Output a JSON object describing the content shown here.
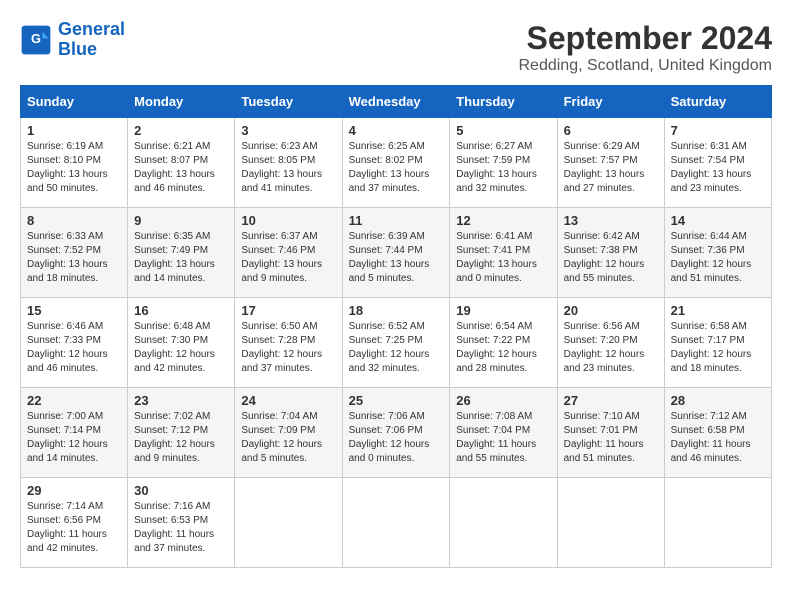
{
  "logo": {
    "line1": "General",
    "line2": "Blue"
  },
  "title": "September 2024",
  "location": "Redding, Scotland, United Kingdom",
  "days_header": [
    "Sunday",
    "Monday",
    "Tuesday",
    "Wednesday",
    "Thursday",
    "Friday",
    "Saturday"
  ],
  "weeks": [
    [
      {
        "day": "1",
        "sunrise": "6:19 AM",
        "sunset": "8:10 PM",
        "daylight": "13 hours and 50 minutes."
      },
      {
        "day": "2",
        "sunrise": "6:21 AM",
        "sunset": "8:07 PM",
        "daylight": "13 hours and 46 minutes."
      },
      {
        "day": "3",
        "sunrise": "6:23 AM",
        "sunset": "8:05 PM",
        "daylight": "13 hours and 41 minutes."
      },
      {
        "day": "4",
        "sunrise": "6:25 AM",
        "sunset": "8:02 PM",
        "daylight": "13 hours and 37 minutes."
      },
      {
        "day": "5",
        "sunrise": "6:27 AM",
        "sunset": "7:59 PM",
        "daylight": "13 hours and 32 minutes."
      },
      {
        "day": "6",
        "sunrise": "6:29 AM",
        "sunset": "7:57 PM",
        "daylight": "13 hours and 27 minutes."
      },
      {
        "day": "7",
        "sunrise": "6:31 AM",
        "sunset": "7:54 PM",
        "daylight": "13 hours and 23 minutes."
      }
    ],
    [
      {
        "day": "8",
        "sunrise": "6:33 AM",
        "sunset": "7:52 PM",
        "daylight": "13 hours and 18 minutes."
      },
      {
        "day": "9",
        "sunrise": "6:35 AM",
        "sunset": "7:49 PM",
        "daylight": "13 hours and 14 minutes."
      },
      {
        "day": "10",
        "sunrise": "6:37 AM",
        "sunset": "7:46 PM",
        "daylight": "13 hours and 9 minutes."
      },
      {
        "day": "11",
        "sunrise": "6:39 AM",
        "sunset": "7:44 PM",
        "daylight": "13 hours and 5 minutes."
      },
      {
        "day": "12",
        "sunrise": "6:41 AM",
        "sunset": "7:41 PM",
        "daylight": "13 hours and 0 minutes."
      },
      {
        "day": "13",
        "sunrise": "6:42 AM",
        "sunset": "7:38 PM",
        "daylight": "12 hours and 55 minutes."
      },
      {
        "day": "14",
        "sunrise": "6:44 AM",
        "sunset": "7:36 PM",
        "daylight": "12 hours and 51 minutes."
      }
    ],
    [
      {
        "day": "15",
        "sunrise": "6:46 AM",
        "sunset": "7:33 PM",
        "daylight": "12 hours and 46 minutes."
      },
      {
        "day": "16",
        "sunrise": "6:48 AM",
        "sunset": "7:30 PM",
        "daylight": "12 hours and 42 minutes."
      },
      {
        "day": "17",
        "sunrise": "6:50 AM",
        "sunset": "7:28 PM",
        "daylight": "12 hours and 37 minutes."
      },
      {
        "day": "18",
        "sunrise": "6:52 AM",
        "sunset": "7:25 PM",
        "daylight": "12 hours and 32 minutes."
      },
      {
        "day": "19",
        "sunrise": "6:54 AM",
        "sunset": "7:22 PM",
        "daylight": "12 hours and 28 minutes."
      },
      {
        "day": "20",
        "sunrise": "6:56 AM",
        "sunset": "7:20 PM",
        "daylight": "12 hours and 23 minutes."
      },
      {
        "day": "21",
        "sunrise": "6:58 AM",
        "sunset": "7:17 PM",
        "daylight": "12 hours and 18 minutes."
      }
    ],
    [
      {
        "day": "22",
        "sunrise": "7:00 AM",
        "sunset": "7:14 PM",
        "daylight": "12 hours and 14 minutes."
      },
      {
        "day": "23",
        "sunrise": "7:02 AM",
        "sunset": "7:12 PM",
        "daylight": "12 hours and 9 minutes."
      },
      {
        "day": "24",
        "sunrise": "7:04 AM",
        "sunset": "7:09 PM",
        "daylight": "12 hours and 5 minutes."
      },
      {
        "day": "25",
        "sunrise": "7:06 AM",
        "sunset": "7:06 PM",
        "daylight": "12 hours and 0 minutes."
      },
      {
        "day": "26",
        "sunrise": "7:08 AM",
        "sunset": "7:04 PM",
        "daylight": "11 hours and 55 minutes."
      },
      {
        "day": "27",
        "sunrise": "7:10 AM",
        "sunset": "7:01 PM",
        "daylight": "11 hours and 51 minutes."
      },
      {
        "day": "28",
        "sunrise": "7:12 AM",
        "sunset": "6:58 PM",
        "daylight": "11 hours and 46 minutes."
      }
    ],
    [
      {
        "day": "29",
        "sunrise": "7:14 AM",
        "sunset": "6:56 PM",
        "daylight": "11 hours and 42 minutes."
      },
      {
        "day": "30",
        "sunrise": "7:16 AM",
        "sunset": "6:53 PM",
        "daylight": "11 hours and 37 minutes."
      },
      null,
      null,
      null,
      null,
      null
    ]
  ]
}
